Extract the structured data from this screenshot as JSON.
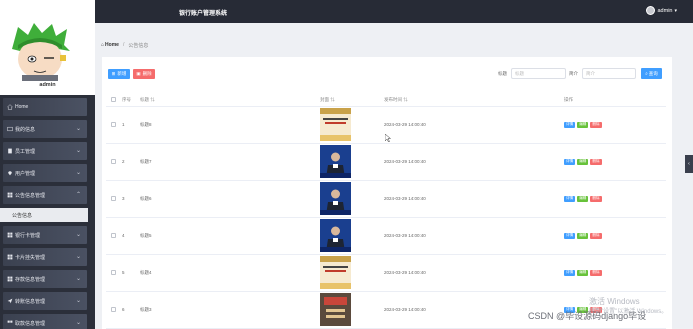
{
  "header": {
    "title": "银行账户管理系统",
    "user": "admin"
  },
  "sidebar": {
    "admin_name": "admin",
    "items": [
      {
        "label": "Home"
      },
      {
        "label": "我的信息"
      },
      {
        "label": "员工管理"
      },
      {
        "label": "用户管理"
      },
      {
        "label": "公告信息管理"
      },
      {
        "label": "公告信息"
      },
      {
        "label": "银行卡管理"
      },
      {
        "label": "卡片挂失管理"
      },
      {
        "label": "存款信息管理"
      },
      {
        "label": "转账信息管理"
      },
      {
        "label": "取款信息管理"
      }
    ]
  },
  "breadcrumb": {
    "home": "Home",
    "current": "公告信息"
  },
  "toolbar": {
    "add_label": "新增",
    "delete_label": "删除",
    "title_label": "标题",
    "title_placeholder": "标题",
    "intro_label": "简介",
    "intro_placeholder": "简介",
    "search_label": "查询"
  },
  "table": {
    "headers": [
      "序号",
      "标题",
      "封面",
      "发布时间",
      "操作"
    ],
    "rows": [
      {
        "index": "1",
        "title": "标题8",
        "time": "2024-03-29 14:00:40",
        "cover": "poster"
      },
      {
        "index": "2",
        "title": "标题7",
        "time": "2024-03-29 14:00:40",
        "cover": "news-anchor"
      },
      {
        "index": "3",
        "title": "标题6",
        "time": "2024-03-29 14:00:40",
        "cover": "news-anchor"
      },
      {
        "index": "4",
        "title": "标题5",
        "time": "2024-03-29 14:00:40",
        "cover": "news-anchor"
      },
      {
        "index": "5",
        "title": "标题4",
        "time": "2024-03-29 14:00:40",
        "cover": "poster"
      },
      {
        "index": "6",
        "title": "标题3",
        "time": "2024-03-29 14:00:40",
        "cover": "news-card"
      }
    ],
    "ops": {
      "detail": "详情",
      "edit": "编辑",
      "delete": "删除"
    }
  },
  "overlay": {
    "watermark": "激活 Windows",
    "watermark_sub": "转到\"设置\"以激活 Windows。",
    "csdn": "CSDN @毕设源码django毕设"
  },
  "colors": {
    "primary": "#409eff",
    "danger": "#f56c6c",
    "success": "#67c23a",
    "sidebar": "#2b2f3a",
    "topbar": "#272b36"
  }
}
